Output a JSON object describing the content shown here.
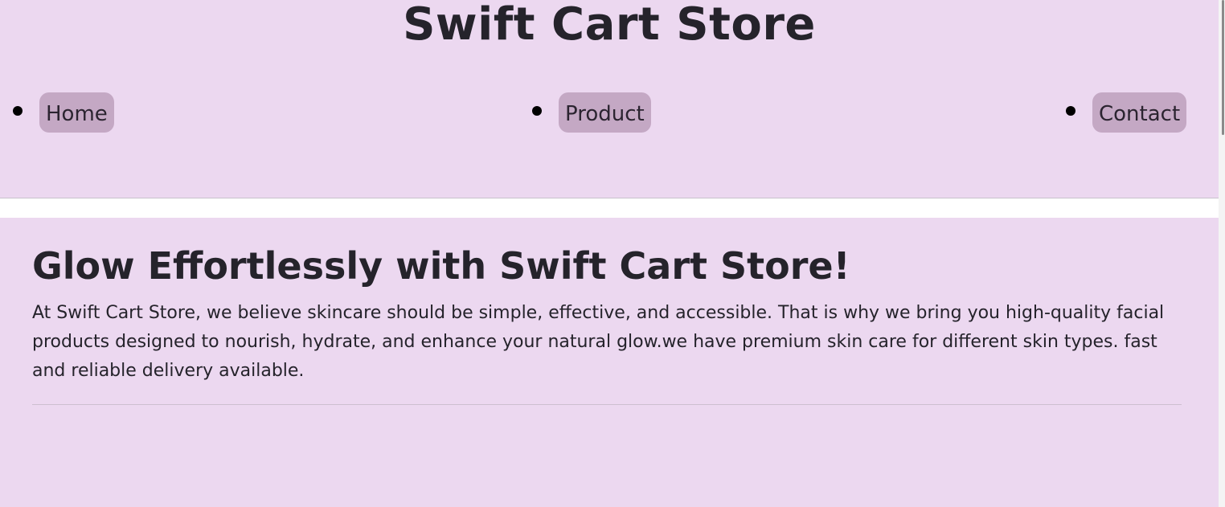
{
  "header": {
    "title": "Swift Cart Store",
    "nav": [
      {
        "label": "Home"
      },
      {
        "label": "Product"
      },
      {
        "label": "Contact"
      }
    ]
  },
  "hero": {
    "heading": "Glow Effortlessly with Swift Cart Store!",
    "text": "At Swift Cart Store, we believe skincare should be simple, effective, and accessible. That is why we bring you high-quality facial products designed to nourish, hydrate, and enhance your natural glow.we have premium skin care for different skin types. fast and reliable delivery available."
  },
  "colors": {
    "background": "#ecd8f0",
    "nav_button": "#c4a8c4",
    "text": "#25232b"
  }
}
